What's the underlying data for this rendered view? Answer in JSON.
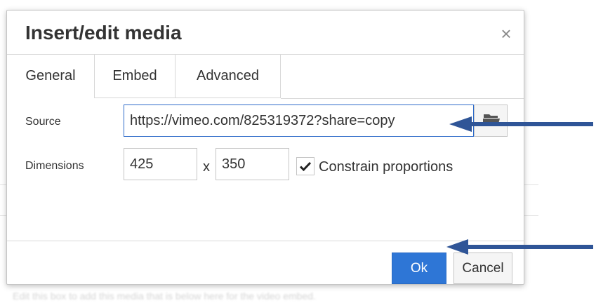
{
  "dialog": {
    "title": "Insert/edit media",
    "close_glyph": "×"
  },
  "tabs": [
    {
      "label": "General",
      "active": true
    },
    {
      "label": "Embed",
      "active": false
    },
    {
      "label": "Advanced",
      "active": false
    }
  ],
  "form": {
    "source_label": "Source",
    "source_value": "https://vimeo.com/825319372?share=copy",
    "dimensions_label": "Dimensions",
    "width_value": "425",
    "separator": "x",
    "height_value": "350",
    "constrain_label": "Constrain proportions",
    "constrain_checked": true
  },
  "buttons": {
    "ok_label": "Ok",
    "cancel_label": "Cancel"
  },
  "icons": {
    "browse": "folder-icon",
    "close": "close-icon",
    "check": "checkmark-icon"
  },
  "colors": {
    "accent": "#2e76d6",
    "arrow": "#2f5597",
    "focus_border": "#2e6bc9"
  },
  "background": {
    "blurred_text": "Edit this box to add this media that is below here for the video embed."
  }
}
